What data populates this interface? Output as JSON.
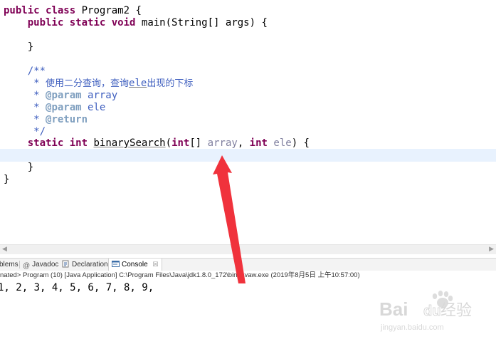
{
  "editor": {
    "lines": [
      {
        "id": "l1",
        "parts": [
          {
            "t": "public",
            "c": "kw"
          },
          {
            "t": " "
          },
          {
            "t": "class",
            "c": "kw"
          },
          {
            "t": " Program2 {"
          }
        ]
      },
      {
        "id": "l2",
        "parts": [
          {
            "t": "    "
          },
          {
            "t": "public",
            "c": "kw"
          },
          {
            "t": " "
          },
          {
            "t": "static",
            "c": "kw"
          },
          {
            "t": " "
          },
          {
            "t": "void",
            "c": "kw"
          },
          {
            "t": " main(String[] args) {"
          }
        ]
      },
      {
        "id": "l3",
        "parts": [
          {
            "t": ""
          }
        ]
      },
      {
        "id": "l4",
        "parts": [
          {
            "t": "    }"
          }
        ]
      },
      {
        "id": "l5",
        "parts": [
          {
            "t": ""
          }
        ]
      },
      {
        "id": "l6",
        "parts": [
          {
            "t": "    /**",
            "c": "cmt"
          }
        ]
      },
      {
        "id": "l7",
        "parts": [
          {
            "t": "     * ",
            "c": "cmt"
          },
          {
            "t": "使用二分查询，查询",
            "c": "cmt cjk"
          },
          {
            "t": "ele",
            "c": "cmt ul"
          },
          {
            "t": "出现的下标",
            "c": "cmt cjk"
          }
        ]
      },
      {
        "id": "l8",
        "parts": [
          {
            "t": "     * ",
            "c": "cmt"
          },
          {
            "t": "@param",
            "c": "ann"
          },
          {
            "t": " array",
            "c": "cmt"
          }
        ]
      },
      {
        "id": "l9",
        "parts": [
          {
            "t": "     * ",
            "c": "cmt"
          },
          {
            "t": "@param",
            "c": "ann"
          },
          {
            "t": " ele",
            "c": "cmt"
          }
        ]
      },
      {
        "id": "l10",
        "parts": [
          {
            "t": "     * ",
            "c": "cmt"
          },
          {
            "t": "@return",
            "c": "ann"
          }
        ]
      },
      {
        "id": "l11",
        "parts": [
          {
            "t": "     */",
            "c": "cmt"
          }
        ]
      },
      {
        "id": "l12",
        "parts": [
          {
            "t": "    "
          },
          {
            "t": "static",
            "c": "kw"
          },
          {
            "t": " "
          },
          {
            "t": "int",
            "c": "kw"
          },
          {
            "t": " "
          },
          {
            "t": "binarySearch",
            "c": "ul"
          },
          {
            "t": "("
          },
          {
            "t": "int",
            "c": "kw"
          },
          {
            "t": "[] "
          },
          {
            "t": "array",
            "c": "param-ref"
          },
          {
            "t": ", "
          },
          {
            "t": "int",
            "c": "kw"
          },
          {
            "t": " "
          },
          {
            "t": "ele",
            "c": "param-ref"
          },
          {
            "t": ") {"
          }
        ]
      },
      {
        "id": "l13",
        "parts": [
          {
            "t": ""
          }
        ]
      },
      {
        "id": "l14",
        "parts": [
          {
            "t": "    }"
          }
        ]
      },
      {
        "id": "l15",
        "parts": [
          {
            "t": "}"
          }
        ]
      }
    ]
  },
  "tabs": {
    "problems": "blems",
    "javadoc": "Javadoc",
    "declaration": "Declaration",
    "console": "Console",
    "console_close": "☒"
  },
  "console": {
    "header": "nated> Program (10) [Java Application] C:\\Program Files\\Java\\jdk1.8.0_172\\bin\\javaw.exe (2019年8月5日 上午10:57:00)",
    "output": "1, 2, 3, 4, 5, 6, 7, 8, 9,"
  },
  "watermark": {
    "brand": "Bai",
    "brand_tail": "du",
    "jingyan_cn": "经验",
    "url": "jingyan.baidu.com"
  },
  "colors": {
    "keyword": "#7f0055",
    "comment": "#3f5fbf",
    "current_line": "#e8f2fe",
    "arrow": "#f0323c"
  }
}
